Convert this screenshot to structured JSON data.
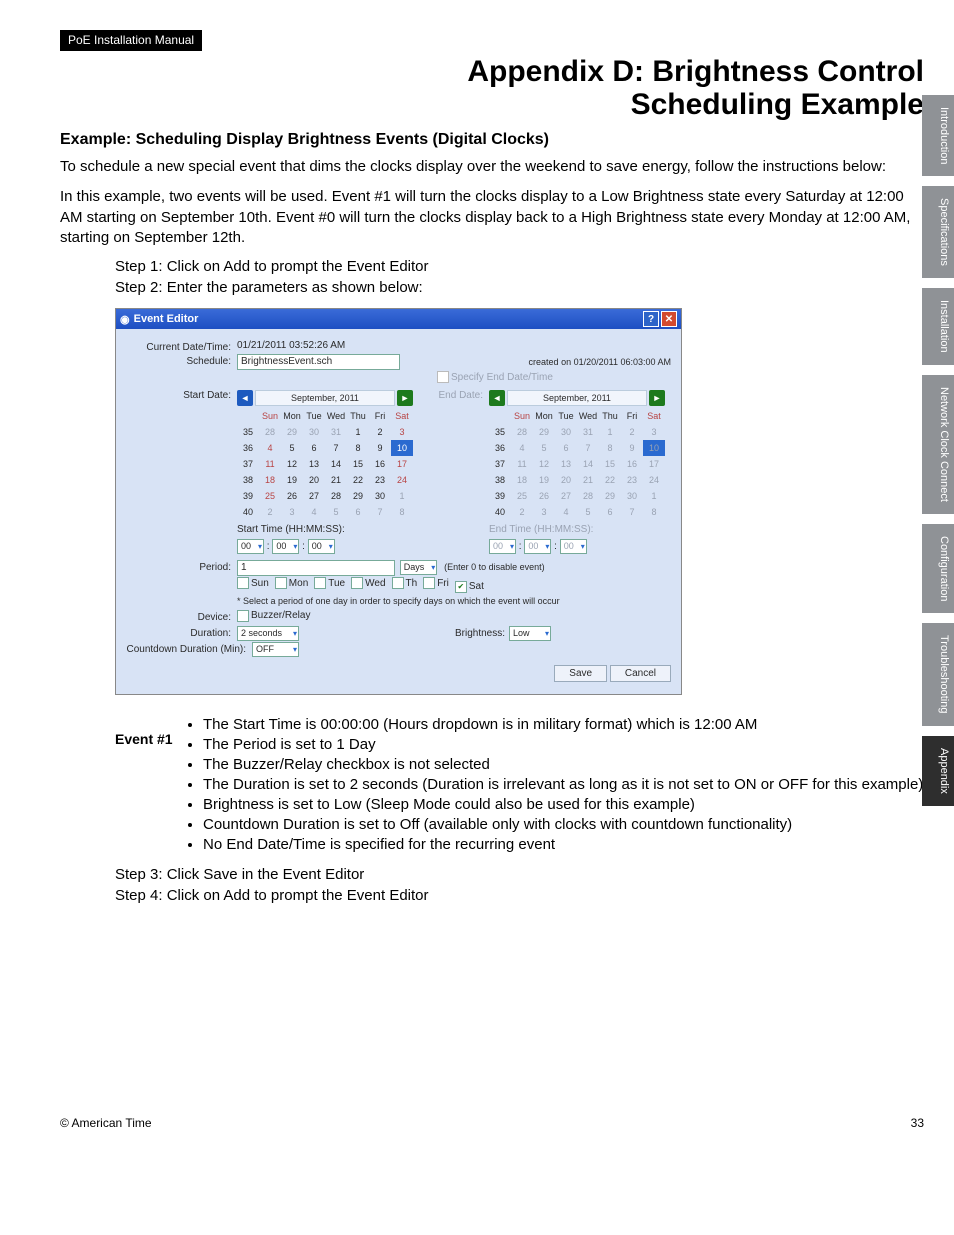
{
  "header": {
    "manual_tab": "PoE Installation Manual",
    "title_line1": "Appendix D: Brightness Control",
    "title_line2": "Scheduling Example"
  },
  "sidebar": {
    "tabs": [
      "Introduction",
      "Specifications",
      "Installation",
      "Network Clock Connect",
      "Configuration",
      "Troubleshooting",
      "Appendix"
    ]
  },
  "example": {
    "heading": "Example: Scheduling Display Brightness Events (Digital Clocks)",
    "p1": "To schedule a new special event that dims the clocks display over the weekend to save energy, follow the instructions below:",
    "p2": "In this example, two events will be used. Event #1 will turn the clocks display to a Low Brightness state every Saturday at 12:00 AM starting on September 10th. Event #0 will turn the clocks display back to a High Brightness state every Monday at 12:00 AM, starting on September 12th.",
    "step1": "Step 1: Click on Add to prompt the Event Editor",
    "step2": "Step 2: Enter the parameters as shown below:",
    "step3": "Step 3: Click Save in the Event Editor",
    "step4": "Step 4: Click on Add to prompt the Event Editor"
  },
  "editor": {
    "title": "Event Editor",
    "current_dt_label": "Current Date/Time:",
    "current_dt_value": "01/21/2011 03:52:26 AM",
    "schedule_label": "Schedule:",
    "schedule_value": "BrightnessEvent.sch",
    "created_on": "created on  01/20/2011 06:03:00 AM",
    "specify_end": "Specify End Date/Time",
    "start_date_label": "Start Date:",
    "end_date_label": "End Date:",
    "month_title": "September,  2011",
    "dow": [
      "Sun",
      "Mon",
      "Tue",
      "Wed",
      "Thu",
      "Fri",
      "Sat"
    ],
    "weeks_start": [
      {
        "wk": "35",
        "d": [
          "28",
          "29",
          "30",
          "31",
          "1",
          "2",
          "3"
        ],
        "gray": [
          0,
          1,
          2,
          3
        ]
      },
      {
        "wk": "36",
        "d": [
          "4",
          "5",
          "6",
          "7",
          "8",
          "9",
          "10"
        ],
        "sel": 6
      },
      {
        "wk": "37",
        "d": [
          "11",
          "12",
          "13",
          "14",
          "15",
          "16",
          "17"
        ]
      },
      {
        "wk": "38",
        "d": [
          "18",
          "19",
          "20",
          "21",
          "22",
          "23",
          "24"
        ]
      },
      {
        "wk": "39",
        "d": [
          "25",
          "26",
          "27",
          "28",
          "29",
          "30",
          "1"
        ],
        "gray": [
          6
        ]
      },
      {
        "wk": "40",
        "d": [
          "2",
          "3",
          "4",
          "5",
          "6",
          "7",
          "8"
        ],
        "gray": [
          0,
          1,
          2,
          3,
          4,
          5,
          6
        ]
      }
    ],
    "weeks_end": [
      {
        "wk": "35",
        "d": [
          "28",
          "29",
          "30",
          "31",
          "1",
          "2",
          "3"
        ]
      },
      {
        "wk": "36",
        "d": [
          "4",
          "5",
          "6",
          "7",
          "8",
          "9",
          "10"
        ],
        "sel": 6
      },
      {
        "wk": "37",
        "d": [
          "11",
          "12",
          "13",
          "14",
          "15",
          "16",
          "17"
        ]
      },
      {
        "wk": "38",
        "d": [
          "18",
          "19",
          "20",
          "21",
          "22",
          "23",
          "24"
        ]
      },
      {
        "wk": "39",
        "d": [
          "25",
          "26",
          "27",
          "28",
          "29",
          "30",
          "1"
        ]
      },
      {
        "wk": "40",
        "d": [
          "2",
          "3",
          "4",
          "5",
          "6",
          "7",
          "8"
        ]
      }
    ],
    "start_time_label": "Start Time (HH:MM:SS):",
    "end_time_label": "End Time (HH:MM:SS):",
    "hh": "00",
    "mm": "00",
    "ss": "00",
    "period_label": "Period:",
    "period_value": "1",
    "period_unit": "Days",
    "period_hint": "(Enter 0 to disable event)",
    "days": [
      "Sun",
      "Mon",
      "Tue",
      "Wed",
      "Th",
      "Fri",
      "Sat"
    ],
    "days_checked": [
      false,
      false,
      false,
      false,
      false,
      false,
      true
    ],
    "days_note": "* Select a period of one day in order to specify days on which the event will occur",
    "device_label": "Device:",
    "device_value": "Buzzer/Relay",
    "duration_label": "Duration:",
    "duration_value": "2 seconds",
    "brightness_label": "Brightness:",
    "brightness_value": "Low",
    "countdown_label": "Countdown Duration (Min):",
    "countdown_value": "OFF",
    "save": "Save",
    "cancel": "Cancel"
  },
  "event1": {
    "label": "Event #1",
    "b1": "The Start Time is 00:00:00 (Hours dropdown is in military format) which is 12:00 AM",
    "b2": "The Period is set to 1 Day",
    "b3": "The Buzzer/Relay checkbox is not selected",
    "b4": "The Duration is set to 2 seconds (Duration is irrelevant as long as it is not set to ON or OFF for this example)",
    "b5": "Brightness is set to Low (Sleep Mode could also be used for this example)",
    "b6": "Countdown Duration is set to Off (available only with clocks with countdown functionality)",
    "b7": "No End Date/Time is specified for the recurring event"
  },
  "footer": {
    "copyright": "© American Time",
    "page": "33"
  }
}
